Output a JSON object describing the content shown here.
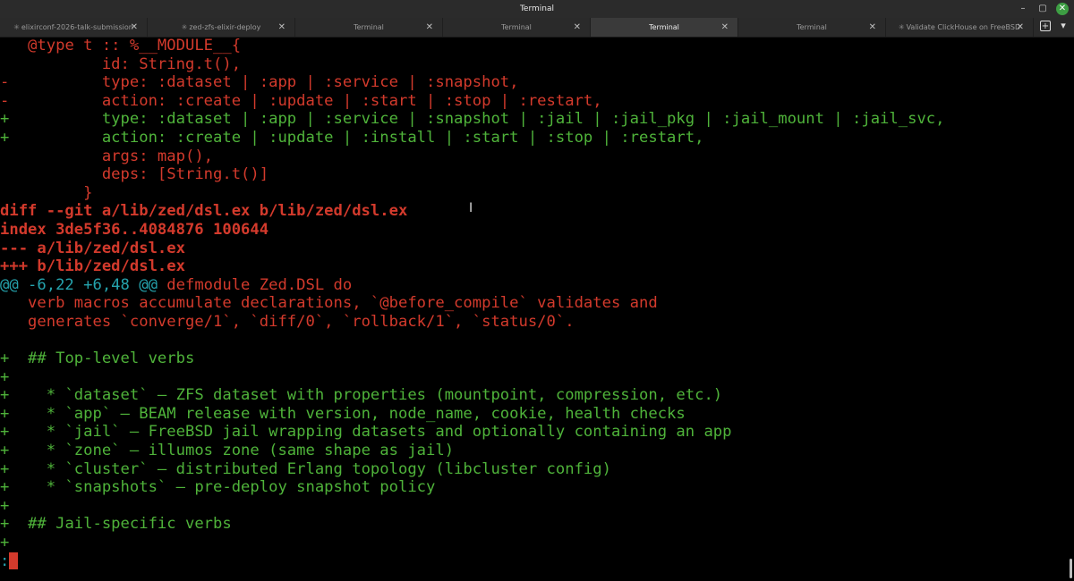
{
  "window": {
    "title": "Terminal"
  },
  "tabs": [
    {
      "label": "elixirconf-2026-talk-submission",
      "dotted": true,
      "active": false
    },
    {
      "label": "zed-zfs-elixir-deploy",
      "dotted": true,
      "active": false
    },
    {
      "label": "Terminal",
      "dotted": false,
      "active": false
    },
    {
      "label": "Terminal",
      "dotted": false,
      "active": false
    },
    {
      "label": "Terminal",
      "dotted": false,
      "active": true
    },
    {
      "label": "Terminal",
      "dotted": false,
      "active": false
    },
    {
      "label": "Validate ClickHouse on FreeBSD",
      "dotted": true,
      "active": false
    }
  ],
  "terminal": {
    "lines": [
      {
        "prefix": " ",
        "text": "  @type t :: %__MODULE__{",
        "color": "red"
      },
      {
        "prefix": " ",
        "text": "          id: String.t(),",
        "color": "red"
      },
      {
        "prefix": "-",
        "text": "          type: :dataset | :app | :service | :snapshot,",
        "color": "red"
      },
      {
        "prefix": "-",
        "text": "          action: :create | :update | :start | :stop | :restart,",
        "color": "red"
      },
      {
        "prefix": "+",
        "text": "          type: :dataset | :app | :service | :snapshot | :jail | :jail_pkg | :jail_mount | :jail_svc,",
        "color": "green"
      },
      {
        "prefix": "+",
        "text": "          action: :create | :update | :install | :start | :stop | :restart,",
        "color": "green"
      },
      {
        "prefix": " ",
        "text": "          args: map(),",
        "color": "red"
      },
      {
        "prefix": " ",
        "text": "          deps: [String.t()]",
        "color": "red"
      },
      {
        "prefix": " ",
        "text": "        }",
        "color": "red"
      },
      {
        "prefix": "",
        "text": "diff --git a/lib/zed/dsl.ex b/lib/zed/dsl.ex",
        "color": "red",
        "bold": true
      },
      {
        "prefix": "",
        "text": "index 3de5f36..4084876 100644",
        "color": "red",
        "bold": true
      },
      {
        "prefix": "",
        "text": "--- a/lib/zed/dsl.ex",
        "color": "red",
        "bold": true
      },
      {
        "prefix": "",
        "text": "+++ b/lib/zed/dsl.ex",
        "color": "red",
        "bold": true
      },
      {
        "prefix": "",
        "hunk": "@@ -6,22 +6,48 @@",
        "text": " defmodule Zed.DSL do",
        "color": "red"
      },
      {
        "prefix": " ",
        "text": "  verb macros accumulate declarations, `@before_compile` validates and",
        "color": "red"
      },
      {
        "prefix": " ",
        "text": "  generates `converge/1`, `diff/0`, `rollback/1`, `status/0`.",
        "color": "red"
      },
      {
        "prefix": " ",
        "text": "",
        "color": "red"
      },
      {
        "prefix": "+",
        "text": "  ## Top-level verbs",
        "color": "green"
      },
      {
        "prefix": "+",
        "text": "",
        "color": "green"
      },
      {
        "prefix": "+",
        "text": "    * `dataset` — ZFS dataset with properties (mountpoint, compression, etc.)",
        "color": "green"
      },
      {
        "prefix": "+",
        "text": "    * `app` — BEAM release with version, node_name, cookie, health checks",
        "color": "green"
      },
      {
        "prefix": "+",
        "text": "    * `jail` — FreeBSD jail wrapping datasets and optionally containing an app",
        "color": "green"
      },
      {
        "prefix": "+",
        "text": "    * `zone` — illumos zone (same shape as jail)",
        "color": "green"
      },
      {
        "prefix": "+",
        "text": "    * `cluster` — distributed Erlang topology (libcluster config)",
        "color": "green"
      },
      {
        "prefix": "+",
        "text": "    * `snapshots` — pre-deploy snapshot policy",
        "color": "green"
      },
      {
        "prefix": "+",
        "text": "",
        "color": "green"
      },
      {
        "prefix": "+",
        "text": "  ## Jail-specific verbs",
        "color": "green"
      },
      {
        "prefix": "+",
        "text": "",
        "color": "green"
      }
    ],
    "prompt": ":"
  },
  "colors": {
    "background": "#000000",
    "removed": "#d33a2c",
    "added": "#4fb33a",
    "hunk": "#25a3ad"
  }
}
